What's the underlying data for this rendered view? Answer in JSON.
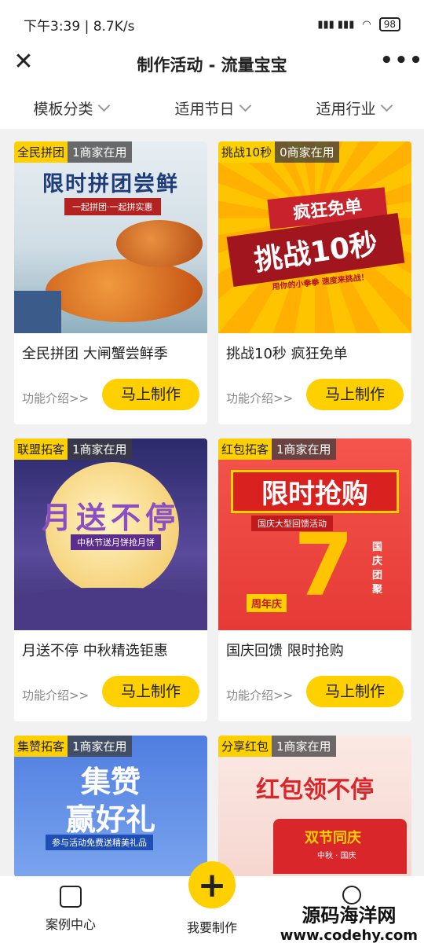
{
  "status": {
    "time_speed": "下午3:39 | 8.7K/s",
    "battery": "98"
  },
  "header": {
    "title": "制作活动 - 流量宝宝"
  },
  "filters": [
    "模板分类",
    "适用节日",
    "适用行业"
  ],
  "cards": [
    {
      "tag": "全民拼团",
      "usage": "1商家在用",
      "name": "全民拼团 大闸蟹尝鲜季",
      "poster_title": "限时拼团尝鲜",
      "poster_sub": "一起拼团·一起拼实惠",
      "intro": "功能介绍>>",
      "button": "马上制作"
    },
    {
      "tag": "挑战10秒",
      "usage": "0商家在用",
      "name": "挑战10秒 疯狂免单",
      "poster_title": "疯狂免单",
      "poster_big": "挑战10秒",
      "poster_sub": "用你的小拳拳  速度来挑战！",
      "intro": "功能介绍>>",
      "button": "马上制作"
    },
    {
      "tag": "联盟拓客",
      "usage": "1商家在用",
      "name": "月送不停 中秋精选钜惠",
      "poster_title": "月送不停",
      "poster_sub": "中秋节送月饼抢月饼",
      "intro": "功能介绍>>",
      "button": "马上制作"
    },
    {
      "tag": "红包拓客",
      "usage": "1商家在用",
      "name": "国庆回馈 限时抢购",
      "poster_title": "限时抢购",
      "poster_sub": "国庆大型回馈活动",
      "poster_num": "7",
      "poster_side": "国庆团聚",
      "poster_badge": "周年庆",
      "intro": "功能介绍>>",
      "button": "马上制作"
    },
    {
      "tag": "集赞拓客",
      "usage": "1商家在用",
      "poster_title": "集赞",
      "poster_title2": "赢好礼",
      "poster_sub": "参与活动免费送精美礼品"
    },
    {
      "tag": "分享红包",
      "usage": "1商家在用",
      "poster_title": "红包领不停",
      "poster_sub": "双节同庆",
      "poster_small": "中秋 · 国庆"
    }
  ],
  "nav": {
    "left": "案例中心",
    "center": "我要制作"
  },
  "watermark": {
    "line1": "源码海洋网",
    "line2": "www.codehy.com"
  }
}
